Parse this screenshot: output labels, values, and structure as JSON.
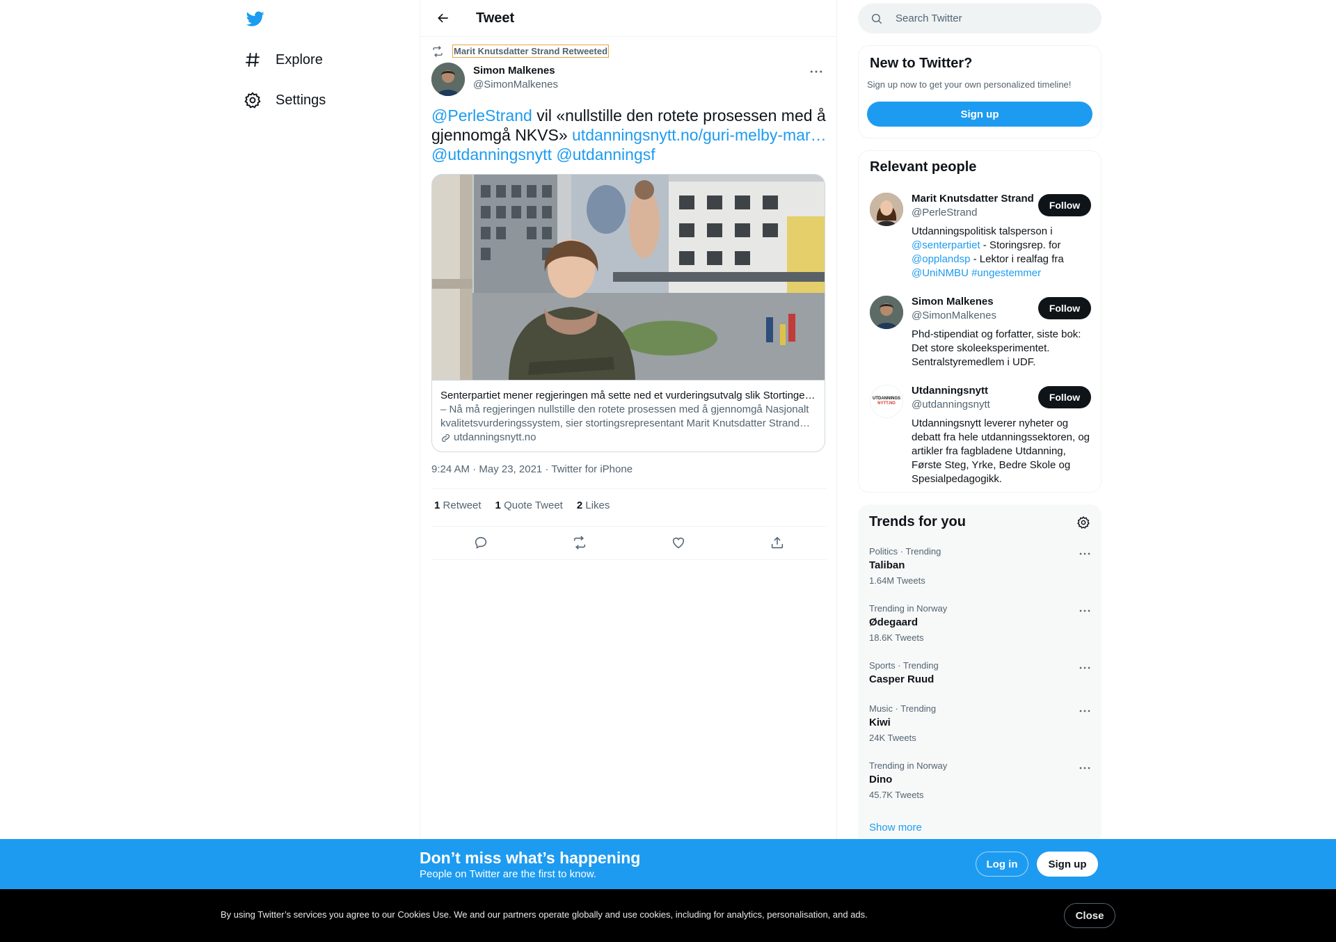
{
  "nav": {
    "items": [
      {
        "label": "Explore",
        "icon": "hashtag-icon"
      },
      {
        "label": "Settings",
        "icon": "gear-icon"
      }
    ]
  },
  "header": {
    "title": "Tweet"
  },
  "tweet": {
    "retweet_context": "Marit Knutsdatter Strand Retweeted",
    "author_name": "Simon Malkenes",
    "author_handle": "@SimonMalkenes",
    "text_mention1": "@PerleStrand",
    "text_body": " vil «nullstille den rotete prosessen med å gjennomgå NKVS» ",
    "text_link": "utdanningsnytt.no/guri-melby-mar…",
    "text_mention2": "@utdanningsnytt",
    "text_mention3": "@utdanningsf",
    "card": {
      "title": "Senterpartiet mener regjeringen må sette ned et vurderingsutvalg slik Stortinget ba om",
      "description": "– Nå må regjeringen nullstille den rotete prosessen med å gjennomgå Nasjonalt kvalitetsvurderingssystem, sier stortingsrepresentant Marit Knutsdatter Strand (Sp).",
      "domain": "utdanningsnytt.no"
    },
    "meta": "9:24 AM · May 23, 2021 · Twitter for iPhone",
    "stats": {
      "retweets_count": "1",
      "retweets_label": "Retweet",
      "quotes_count": "1",
      "quotes_label": "Quote Tweet",
      "likes_count": "2",
      "likes_label": "Likes"
    }
  },
  "search": {
    "placeholder": "Search Twitter"
  },
  "new_to_twitter": {
    "title": "New to Twitter?",
    "subtitle": "Sign up now to get your own personalized timeline!",
    "button": "Sign up"
  },
  "relevant_people": {
    "title": "Relevant people",
    "follow_label": "Follow",
    "people": [
      {
        "name": "Marit Knutsdatter Strand",
        "handle": "@PerleStrand",
        "bio_1": "Utdanningspolitisk talsperson i ",
        "bio_2": "@senterpartiet",
        "bio_3": " - Storingsrep. for ",
        "bio_4": "@opplandsp",
        "bio_5": " - Lektor i realfag fra ",
        "bio_6": "@UniNMBU",
        "bio_7": " ",
        "bio_8": "#ungestemmer"
      },
      {
        "name": "Simon Malkenes",
        "handle": "@SimonMalkenes",
        "bio": "Phd-stipendiat og forfatter, siste bok: Det store skoleeksperimentet. Sentralstyremedlem i UDF."
      },
      {
        "name": "Utdanningsnytt",
        "handle": "@utdanningsnytt",
        "logo_line1": "UTDANNINGS",
        "logo_line2": "NYTT.NO",
        "bio": "Utdanningsnytt leverer nyheter og debatt fra hele utdanningssektoren, og artikler fra fagbladene Utdanning, Første Steg, Yrke, Bedre Skole og Spesialpedagogikk."
      }
    ]
  },
  "trends": {
    "title": "Trends for you",
    "items": [
      {
        "context": "Politics · Trending",
        "name": "Taliban",
        "count": "1.64M Tweets"
      },
      {
        "context": "Trending in Norway",
        "name": "Ødegaard",
        "count": "18.6K Tweets"
      },
      {
        "context": "Sports · Trending",
        "name": "Casper Ruud",
        "count": ""
      },
      {
        "context": "Music · Trending",
        "name": "Kiwi",
        "count": "24K Tweets"
      },
      {
        "context": "Trending in Norway",
        "name": "Dino",
        "count": "45.7K Tweets"
      }
    ],
    "show_more": "Show more"
  },
  "signup_bar": {
    "title": "Don’t miss what’s happening",
    "subtitle": "People on Twitter are the first to know.",
    "login": "Log in",
    "signup": "Sign up"
  },
  "cookie_bar": {
    "text": "By using Twitter’s services you agree to our Cookies Use. We and our partners operate globally and use cookies, including for analytics, personalisation, and ads.",
    "close": "Close"
  },
  "colors": {
    "accent": "#1d9bf0",
    "text": "#0f1419",
    "muted": "#536471"
  }
}
